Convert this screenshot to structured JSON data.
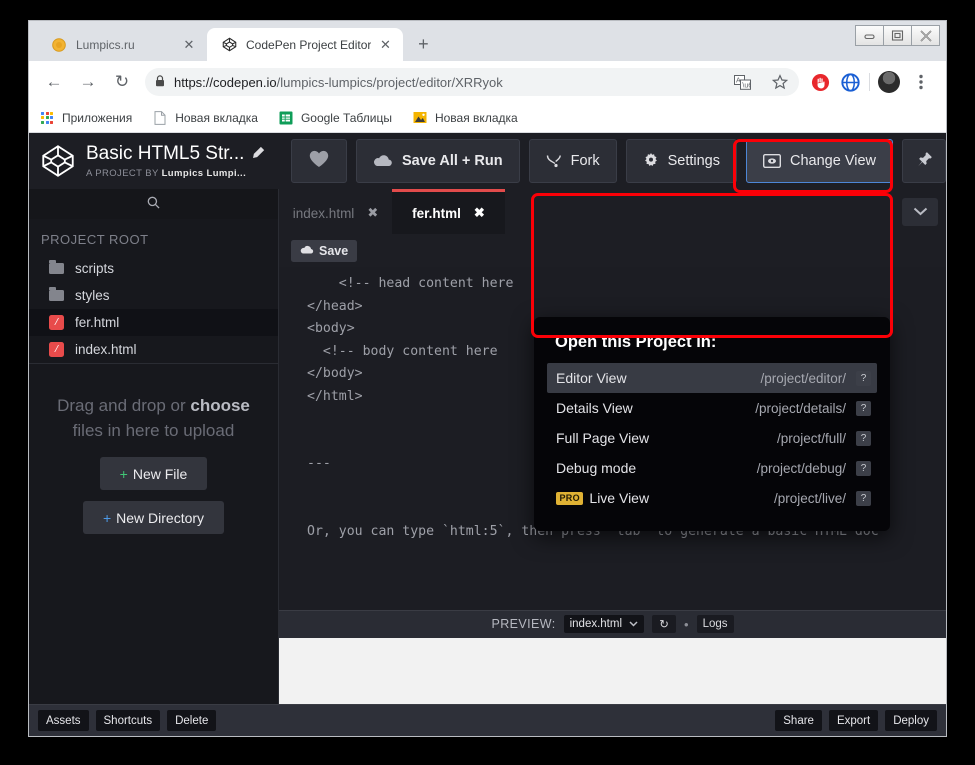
{
  "browser": {
    "tabs": [
      {
        "title": "Lumpics.ru",
        "favicon": "lumpics-icon",
        "active": false
      },
      {
        "title": "CodePen Project Editor",
        "favicon": "codepen-icon",
        "active": true
      }
    ],
    "new_tab_label": "+",
    "close_label": "✕",
    "window_controls": {
      "minimize": "—",
      "maximize": "□",
      "close": "✕"
    },
    "nav": {
      "back": "←",
      "forward": "→",
      "reload": "↻"
    },
    "url": {
      "lock": "🔒",
      "scheme": "https://",
      "host": "codepen.io",
      "path": "/lumpics-lumpics/project/editor/XRRyok"
    },
    "omnibox_icons": [
      "translate-icon",
      "bookmark-star-icon"
    ],
    "toolbar_icons": [
      "adblock-icon",
      "opera-vpn-icon",
      "profile-avatar",
      "chrome-menu-icon"
    ],
    "bookmarks": [
      {
        "label": "Приложения",
        "icon": "apps-grid-icon"
      },
      {
        "label": "Новая вкладка",
        "icon": "page-icon"
      },
      {
        "label": "Google Таблицы",
        "icon": "sheets-icon"
      },
      {
        "label": "Новая вкладка",
        "icon": "image-icon"
      }
    ]
  },
  "app": {
    "header": {
      "logo": "codepen-logo-icon",
      "project_title": "Basic HTML5 Str...",
      "edit_icon": "pencil-icon",
      "byline_prefix": "A PROJECT BY",
      "byline_author": "Lumpics Lumpi...",
      "heart_icon": "heart-icon",
      "save_all_label": "Save All + Run",
      "save_all_icon": "cloud-icon",
      "fork_label": "Fork",
      "fork_icon": "fork-icon",
      "settings_label": "Settings",
      "settings_icon": "gear-icon",
      "change_view_label": "Change View",
      "change_view_icon": "view-icon",
      "pin_icon": "pin-icon"
    },
    "sidebar": {
      "search_icon": "search-icon",
      "root_label": "PROJECT ROOT",
      "files": [
        {
          "name": "scripts",
          "type": "folder",
          "selected": false
        },
        {
          "name": "styles",
          "type": "folder",
          "selected": false
        },
        {
          "name": "fer.html",
          "type": "html",
          "selected": true
        },
        {
          "name": "index.html",
          "type": "html",
          "selected": false
        }
      ],
      "drop_line1": "Drag and drop or",
      "drop_choose": "choose",
      "drop_line2": " files in here to",
      "drop_line3": "upload",
      "new_file_label": "New File",
      "new_dir_label": "New Directory",
      "plus": "+"
    },
    "editor": {
      "tabs": [
        {
          "label": "index.html",
          "active": false
        },
        {
          "label": "fer.html",
          "active": true
        }
      ],
      "tab_close": "✖",
      "chevron_icon": "chevron-down-icon",
      "save_label": "Save",
      "save_icon": "cloud-icon",
      "code": "    <!-- head content here\n</head>\n<body>\n  <!-- body content here\n</body>\n</html>\n\n\n---\n\n\nOr, you can type `html:5`, then press `tab` to generate a basic HTML doc"
    },
    "preview": {
      "label": "PREVIEW:",
      "file": "index.html",
      "dropdown_icon": "chevron-down-icon",
      "refresh_icon": "↻",
      "dot_icon": "•",
      "logs_label": "Logs"
    },
    "bottom": {
      "left": [
        "Assets",
        "Shortcuts",
        "Delete"
      ],
      "right": [
        "Share",
        "Export",
        "Deploy"
      ]
    },
    "dropdown": {
      "title": "Open this Project in:",
      "help_glyph": "?",
      "items": [
        {
          "name": "Editor View",
          "path": "/project/editor/",
          "active": true,
          "pro": false
        },
        {
          "name": "Details View",
          "path": "/project/details/",
          "active": false,
          "pro": false
        },
        {
          "name": "Full Page View",
          "path": "/project/full/",
          "active": false,
          "pro": false
        },
        {
          "name": "Debug mode",
          "path": "/project/debug/",
          "active": false,
          "pro": false
        },
        {
          "name": "Live View",
          "path": "/project/live/",
          "active": false,
          "pro": true,
          "pro_label": "PRO"
        }
      ]
    }
  },
  "colors": {
    "annotation": "#fb0007",
    "accent_blue": "#4d86d6",
    "html_file": "#e84b4b",
    "pro_gold": "#e0b234",
    "green_plus": "#41c776",
    "blue_plus": "#4d9ae8"
  }
}
